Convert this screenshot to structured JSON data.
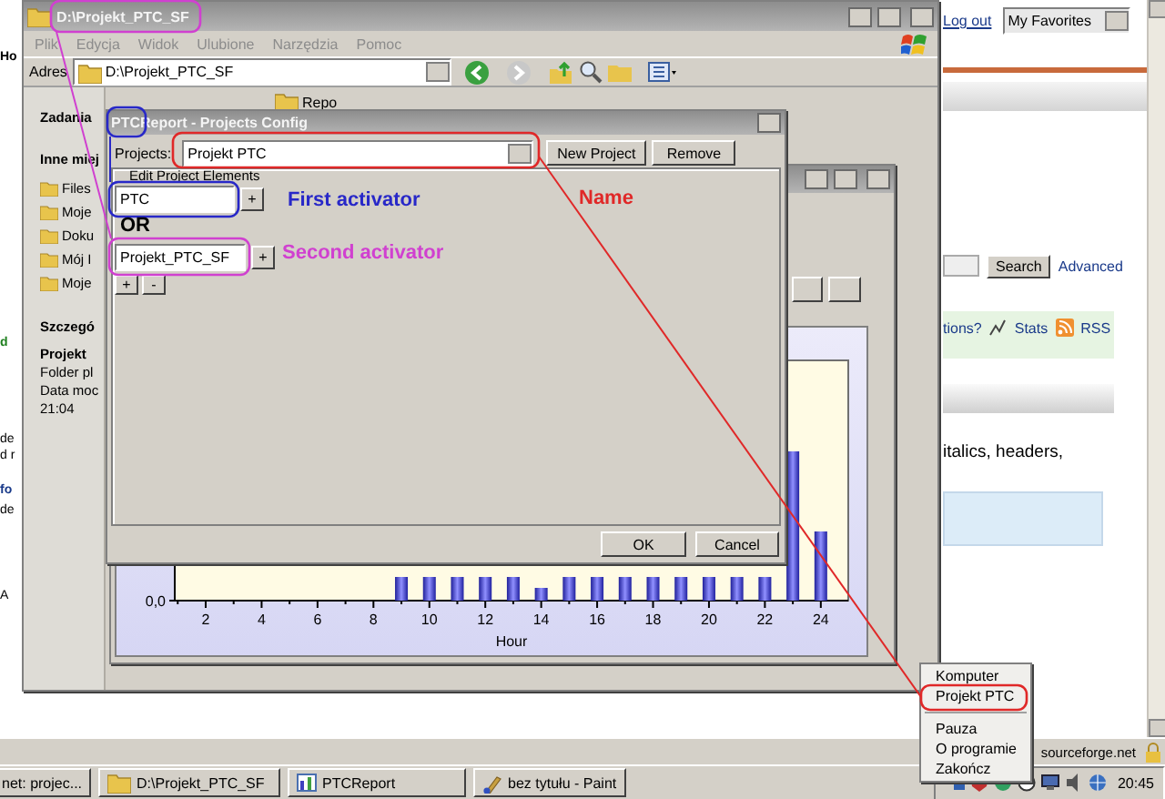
{
  "browser_page": {
    "left_fragments": [
      "Ho",
      "d",
      "de",
      "d r",
      "fo",
      "de",
      "A"
    ],
    "logout_link": "Log out",
    "favorites_select": "My Favorites",
    "search_button": "Search",
    "advanced_link": "Advanced",
    "help_link": "tions?",
    "stats_link": "Stats",
    "rss_link": "RSS",
    "body_text": "italics, headers,",
    "status_text": "sourceforge.net"
  },
  "explorer": {
    "title": "D:\\Projekt_PTC_SF",
    "menu": [
      "Plik",
      "Edycja",
      "Widok",
      "Ulubione",
      "Narzędzia",
      "Pomoc"
    ],
    "address_label": "Adres",
    "address": "D:\\Projekt_PTC_SF",
    "folder": "Repo",
    "sidebar": [
      {
        "kind": "heading",
        "text": "Zadania"
      },
      {
        "kind": "heading",
        "text": "Inne miej"
      },
      {
        "kind": "place",
        "text": "Files"
      },
      {
        "kind": "place",
        "text": "Moje"
      },
      {
        "kind": "place",
        "text": "Doku"
      },
      {
        "kind": "place",
        "text": "Mój I"
      },
      {
        "kind": "place",
        "text": "Moje"
      },
      {
        "kind": "heading",
        "text": "Szczegó"
      },
      {
        "kind": "heading",
        "text": "Projekt"
      },
      {
        "kind": "text",
        "text": "Folder pl"
      },
      {
        "kind": "text",
        "text": "Data moc"
      },
      {
        "kind": "text",
        "text": "21:04"
      }
    ]
  },
  "report_window": {
    "y_tick": "0,0",
    "x_ticks": [
      "2",
      "4",
      "6",
      "8",
      "10",
      "12",
      "14",
      "16",
      "18",
      "20",
      "22",
      "24"
    ],
    "x_label": "Hour"
  },
  "config_dialog": {
    "title": "PTCReport - Projects Config",
    "projects_label": "Projects:",
    "project": "Projekt PTC",
    "new_button": "New Project",
    "remove_button": "Remove",
    "group_label": "Edit Project Elements",
    "elements": [
      {
        "value": "PTC",
        "button": "+"
      },
      {
        "value": "Projekt_PTC_SF",
        "button": "+"
      }
    ],
    "list_buttons": [
      "+",
      "-"
    ],
    "ok_button": "OK",
    "cancel_button": "Cancel"
  },
  "annotations": [
    {
      "text": "First activator",
      "color": "#2828c8"
    },
    {
      "text": "OR",
      "color": "#000000"
    },
    {
      "text": "Second activator",
      "color": "#d040d0"
    },
    {
      "text": "Name",
      "color": "#e02828"
    }
  ],
  "context_menu": {
    "items": [
      {
        "kind": "item",
        "label": "Komputer"
      },
      {
        "kind": "item",
        "label": "Projekt PTC"
      },
      {
        "kind": "separator"
      },
      {
        "kind": "item",
        "label": "Pauza"
      },
      {
        "kind": "item",
        "label": "O programie"
      },
      {
        "kind": "item",
        "label": "Zakończ"
      }
    ]
  },
  "taskbar": {
    "buttons": [
      {
        "kind": "browser",
        "label": "net: projec..."
      },
      {
        "kind": "folder",
        "label": "D:\\Projekt_PTC_SF"
      },
      {
        "kind": "app",
        "label": "PTCReport"
      },
      {
        "kind": "paint",
        "label": "bez tytułu - Paint"
      }
    ],
    "clock": "20:45"
  }
}
